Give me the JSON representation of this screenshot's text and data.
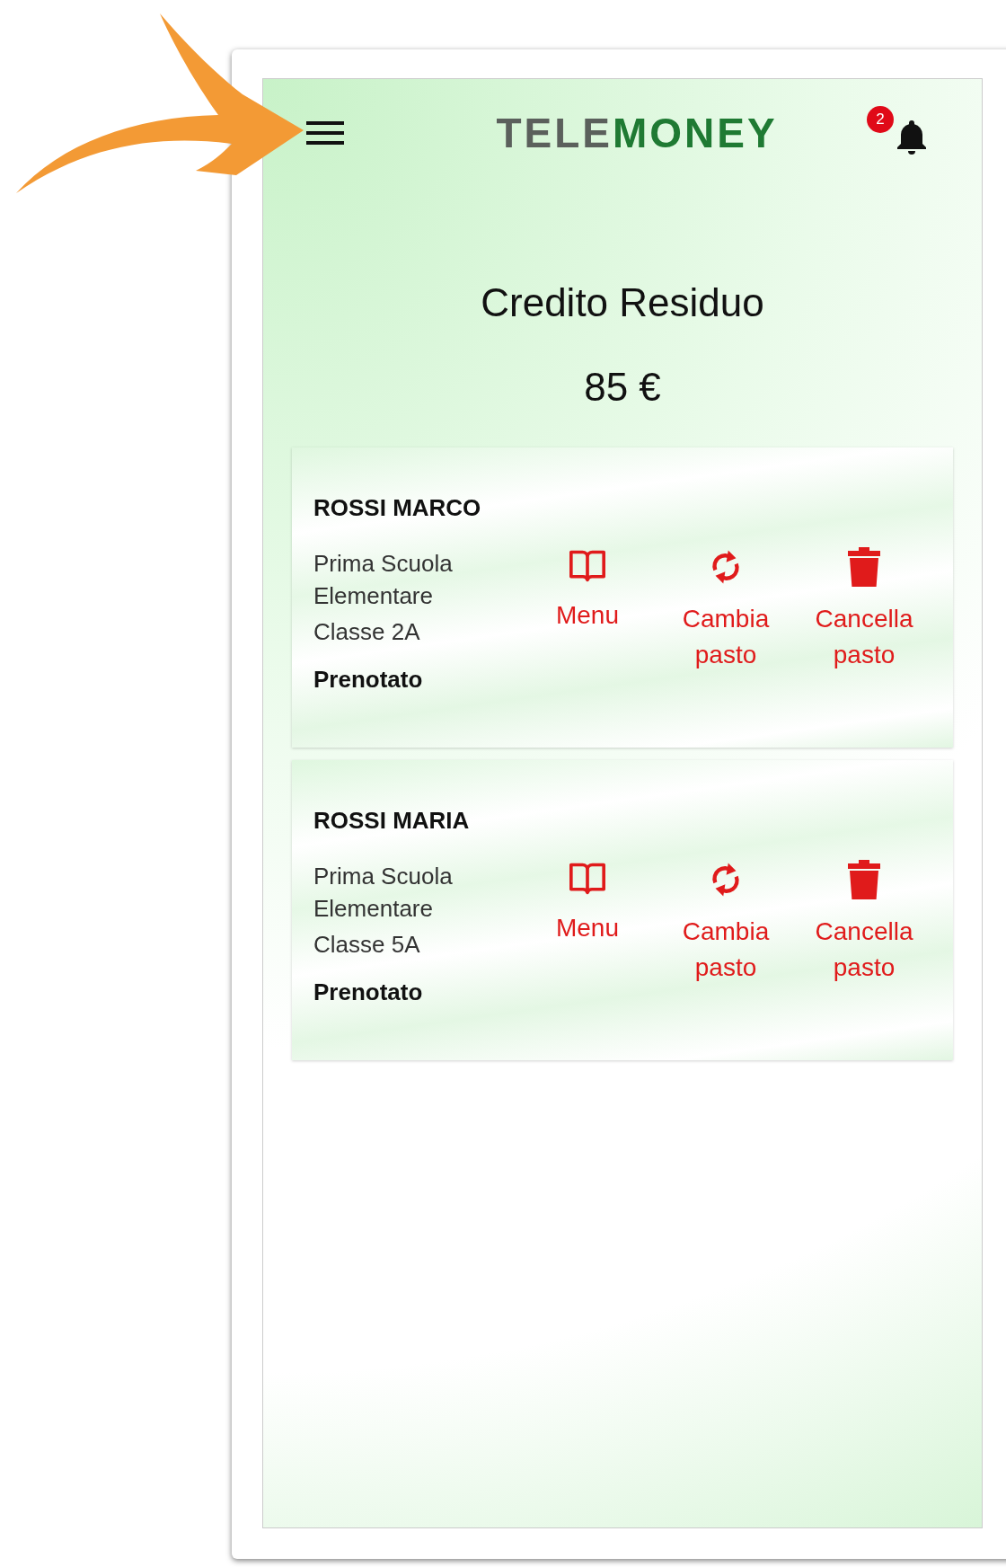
{
  "header": {
    "logo": [
      {
        "text": "TELE",
        "color": "#5b605c"
      },
      {
        "text": "MONEY",
        "color": "#1f7a33"
      }
    ],
    "notification_count": "2"
  },
  "balance": {
    "title": "Credito Residuo",
    "amount": "85 €"
  },
  "students": [
    {
      "name": "ROSSI MARCO",
      "school": "Prima Scuola Elementare",
      "class": "Classe 2A",
      "status": "Prenotato",
      "actions": [
        {
          "kind": "menu",
          "label": "Menu"
        },
        {
          "kind": "change",
          "label": "Cambia pasto"
        },
        {
          "kind": "cancel",
          "label": "Cancella pasto"
        }
      ]
    },
    {
      "name": "ROSSI MARIA",
      "school": "Prima Scuola Elementare",
      "class": "Classe 5A",
      "status": "Prenotato",
      "actions": [
        {
          "kind": "menu",
          "label": "Menu"
        },
        {
          "kind": "change",
          "label": "Cambia pasto"
        },
        {
          "kind": "cancel",
          "label": "Cancella pasto"
        }
      ]
    }
  ]
}
